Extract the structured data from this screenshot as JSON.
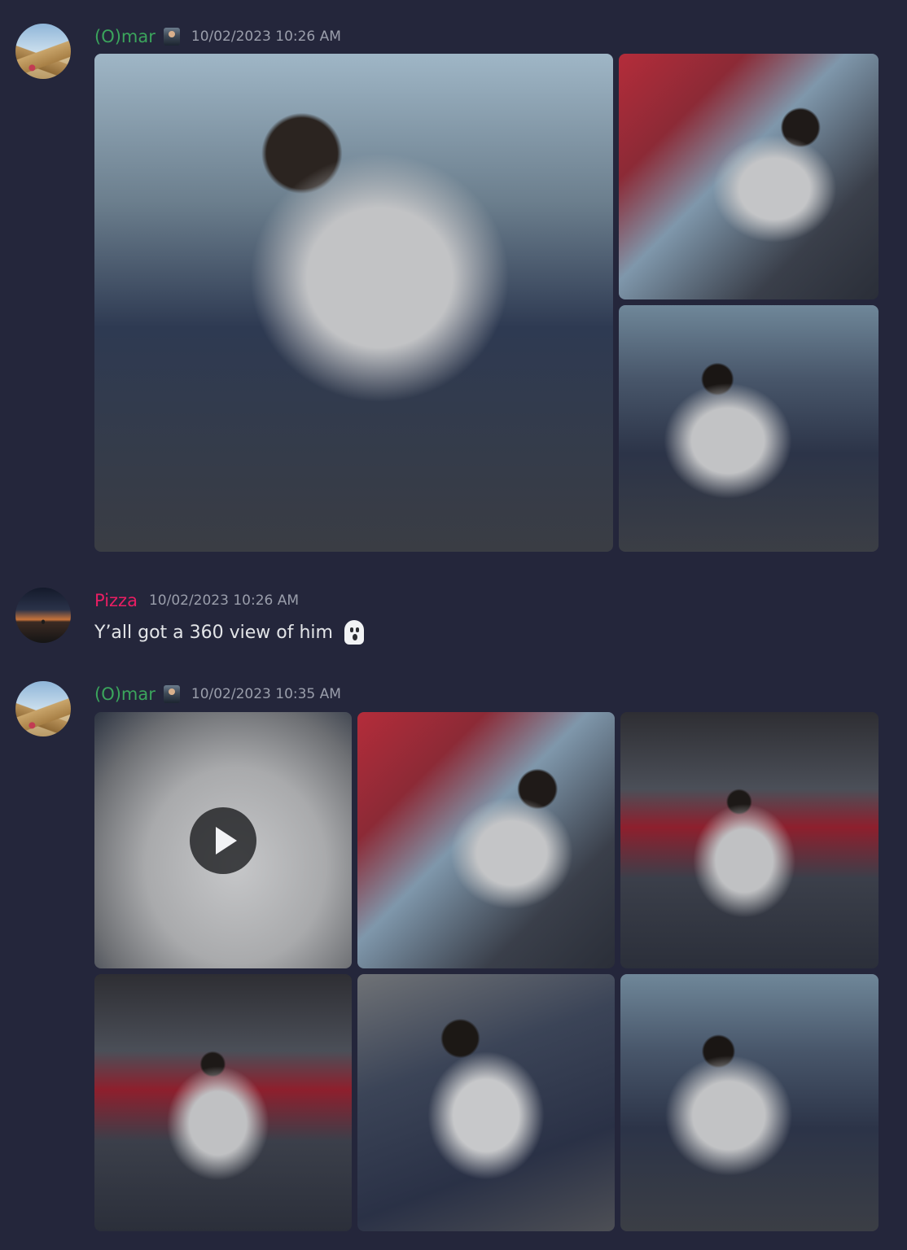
{
  "messages": [
    {
      "author": "(O)mar",
      "author_color": "#3ba55c",
      "timestamp": "10/02/2023 10:26 AM",
      "avatar": "pyramid-avatar",
      "attachments": [
        "photo",
        "photo",
        "photo"
      ]
    },
    {
      "author": "Pizza",
      "author_color": "#e91e63",
      "timestamp": "10/02/2023 10:26 AM",
      "avatar": "sunset-silhouette-avatar",
      "text": "Y’all got a 360 view of him",
      "emoji": "ghost-emoji"
    },
    {
      "author": "(O)mar",
      "author_color": "#3ba55c",
      "timestamp": "10/02/2023 10:35 AM",
      "avatar": "pyramid-avatar",
      "attachments": [
        "video",
        "photo",
        "photo",
        "photo",
        "photo",
        "photo"
      ]
    }
  ]
}
